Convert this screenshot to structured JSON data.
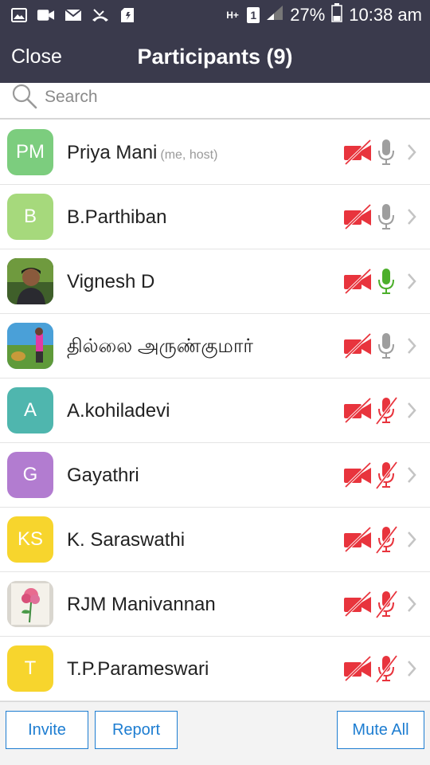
{
  "status_bar": {
    "network_label": "H+",
    "sim_label": "1",
    "battery_percent": "27%",
    "time": "10:38 am",
    "icons": [
      "gallery-icon",
      "video-icon",
      "mail-icon",
      "missed-call-icon",
      "sd-card-icon",
      "signal-icon",
      "battery-icon"
    ]
  },
  "header": {
    "close_label": "Close",
    "title": "Participants (9)",
    "background": "#3a3a4c"
  },
  "search": {
    "placeholder": "Search"
  },
  "participants": [
    {
      "initials": "PM",
      "name": "Priya Mani",
      "tag": "(me, host)",
      "avatar_color": "#7ccd7e",
      "avatar_type": "initials",
      "mic": "on",
      "mic_active": false,
      "video": "off"
    },
    {
      "initials": "B",
      "name": "B.Parthiban",
      "tag": "",
      "avatar_color": "#a6d97c",
      "avatar_type": "initials",
      "mic": "on",
      "mic_active": false,
      "video": "off"
    },
    {
      "initials": "",
      "name": "Vignesh D",
      "tag": "",
      "avatar_color": "#3f5f2a",
      "avatar_type": "photo-person",
      "mic": "on",
      "mic_active": true,
      "video": "off"
    },
    {
      "initials": "",
      "name": "தில்லை அருண்குமார்",
      "tag": "",
      "avatar_color": "#4aa0d8",
      "avatar_type": "photo-outdoor",
      "mic": "on",
      "mic_active": false,
      "video": "off"
    },
    {
      "initials": "A",
      "name": "A.kohiladevi",
      "tag": "",
      "avatar_color": "#4fb6ae",
      "avatar_type": "initials",
      "mic": "off",
      "mic_active": false,
      "video": "off"
    },
    {
      "initials": "G",
      "name": "Gayathri",
      "tag": "",
      "avatar_color": "#b27cd0",
      "avatar_type": "initials",
      "mic": "off",
      "mic_active": false,
      "video": "off"
    },
    {
      "initials": "KS",
      "name": "K. Saraswathi",
      "tag": "",
      "avatar_color": "#f7d52d",
      "avatar_type": "initials",
      "mic": "off",
      "mic_active": false,
      "video": "off"
    },
    {
      "initials": "",
      "name": "RJM Manivannan",
      "tag": "",
      "avatar_color": "#d9d6cf",
      "avatar_type": "photo-flower",
      "mic": "off",
      "mic_active": false,
      "video": "off"
    },
    {
      "initials": "T",
      "name": "T.P.Parameswari",
      "tag": "",
      "avatar_color": "#f7d52d",
      "avatar_type": "initials",
      "mic": "off",
      "mic_active": false,
      "video": "off"
    }
  ],
  "bottom_bar": {
    "invite_label": "Invite",
    "report_label": "Report",
    "mute_all_label": "Mute All",
    "accent": "#1d7dd1"
  },
  "colors": {
    "muted_red": "#e8343d",
    "mic_gray": "#9e9e9e",
    "mic_active_green": "#4caf2b"
  }
}
